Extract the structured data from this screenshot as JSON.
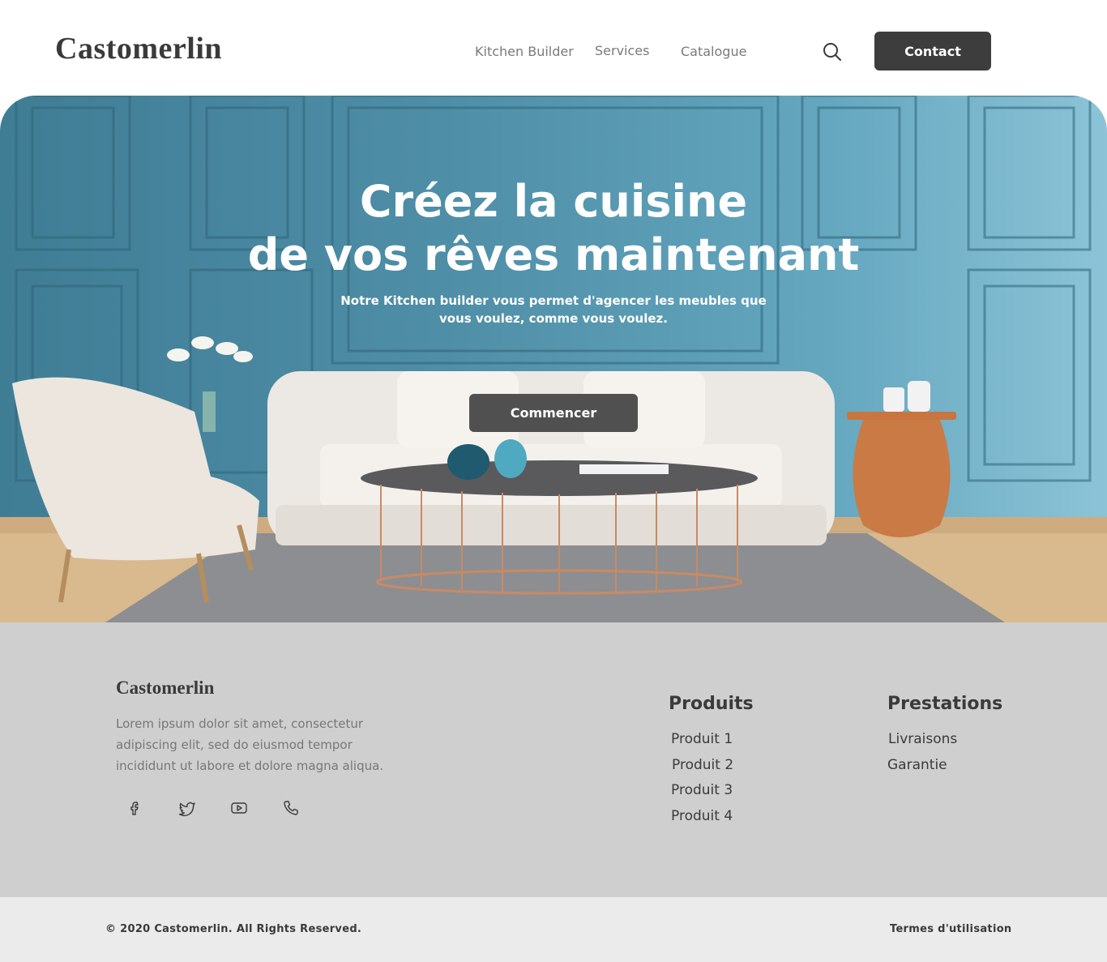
{
  "brand": {
    "logo": "Castomerlin"
  },
  "nav": {
    "items": [
      {
        "label": "Kitchen Builder"
      },
      {
        "label": "Services"
      },
      {
        "label": "Catalogue"
      }
    ],
    "search_icon": "search-icon",
    "contact_label": "Contact"
  },
  "hero": {
    "title_line1": "Créez la cuisine",
    "title_line2": "de vos rêves maintenant",
    "subtitle": "Notre Kitchen builder vous permet d'agencer les meubles que vous voulez, comme vous voulez.",
    "cta_label": "Commencer"
  },
  "footer": {
    "logo": "Castomerlin",
    "description": "Lorem ipsum dolor sit amet, consectetur adipiscing elit, sed do eiusmod tempor incididunt ut labore et dolore magna aliqua.",
    "social": [
      "facebook-icon",
      "twitter-icon",
      "youtube-icon",
      "phone-icon"
    ],
    "columns": [
      {
        "title": "Produits",
        "links": [
          "Produit 1",
          "Produit 2",
          "Produit 3",
          "Produit 4"
        ]
      },
      {
        "title": "Prestations",
        "links": [
          "Livraisons",
          "Garantie"
        ]
      }
    ]
  },
  "bottom": {
    "copyright": "© 2020 Castomerlin.  All Rights Reserved.",
    "terms": "Termes d'utilisation"
  },
  "colors": {
    "dark_button": "#3d3d3d",
    "hero_wall": "#4e8ea6",
    "footer_bg": "#cfcfcf",
    "bottom_bg": "#ebebeb"
  }
}
